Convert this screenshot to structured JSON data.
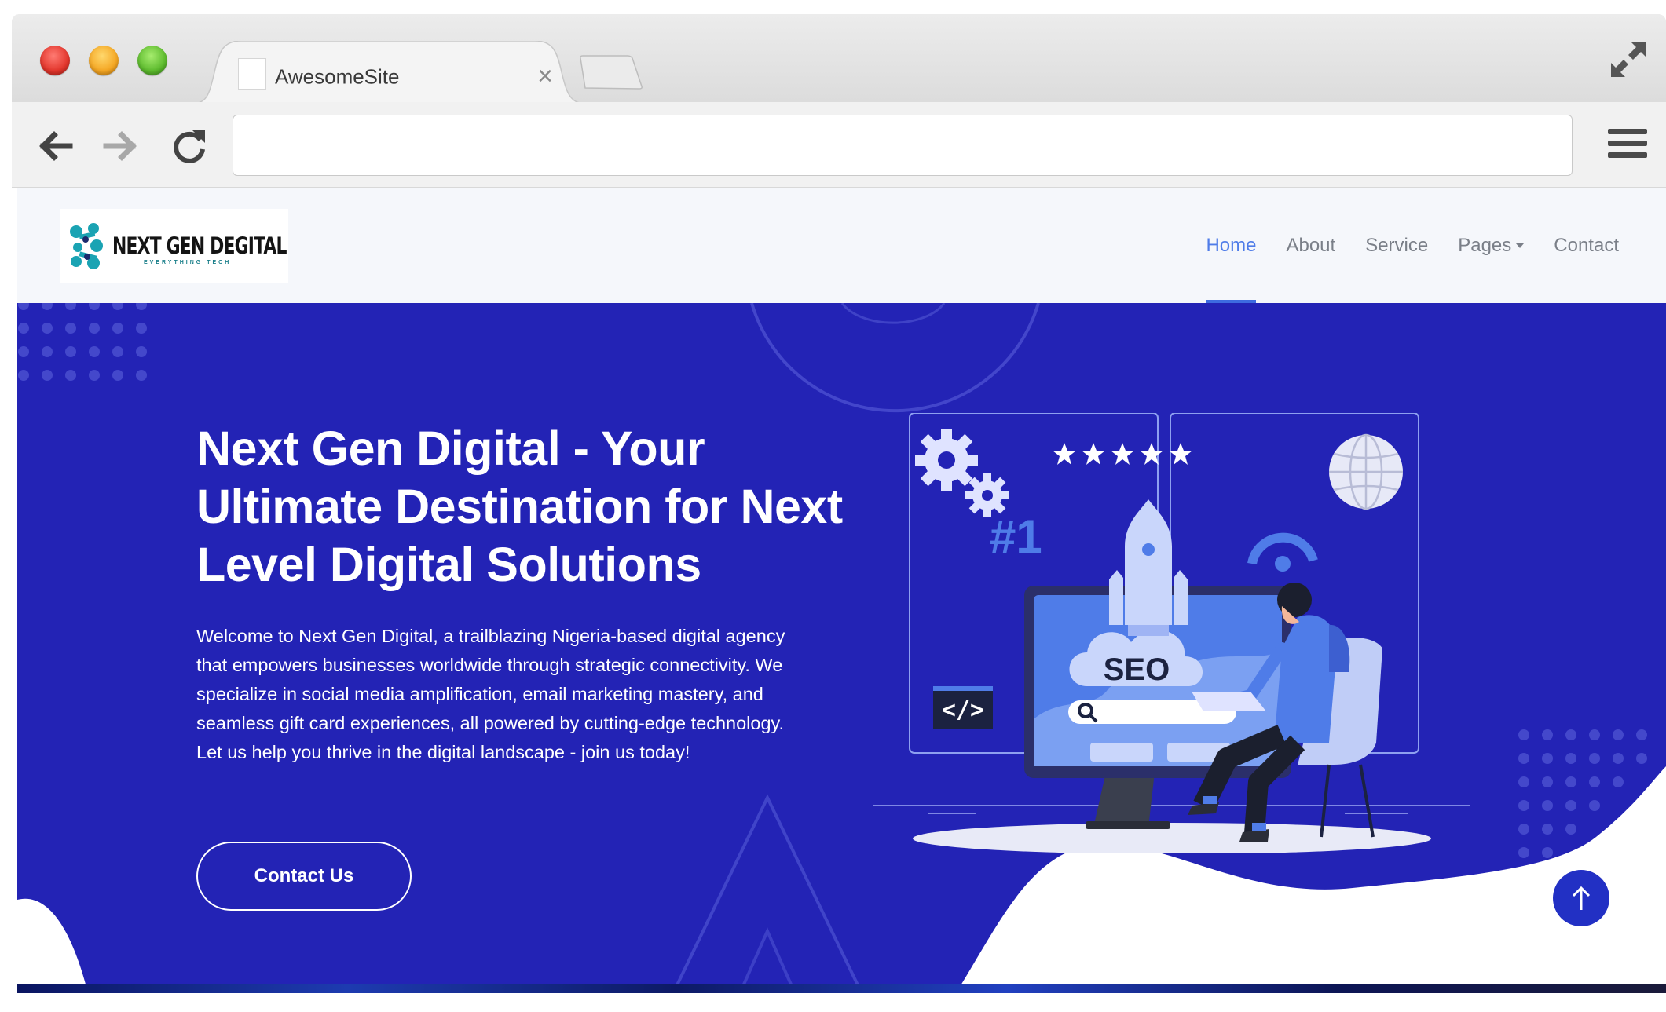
{
  "browser": {
    "tab_title": "AwesomeSite",
    "url": ""
  },
  "site": {
    "logo": {
      "name": "NEXT GEN DEGITAL",
      "tagline": "EVERYTHING TECH"
    },
    "nav": {
      "items": [
        {
          "label": "Home",
          "active": true
        },
        {
          "label": "About",
          "active": false
        },
        {
          "label": "Service",
          "active": false
        },
        {
          "label": "Pages",
          "active": false,
          "dropdown": true
        },
        {
          "label": "Contact",
          "active": false
        }
      ]
    },
    "hero": {
      "title": "Next Gen Digital - Your Ultimate Destination for Next Level Digital Solutions",
      "description": "Welcome to Next Gen Digital, a trailblazing Nigeria-based digital agency that empowers businesses worldwide through strategic connectivity. We specialize in social media amplification, email marketing mastery, and seamless gift card experiences, all powered by cutting-edge technology. Let us help you thrive in the digital landscape - join us today!",
      "cta_label": "Contact Us",
      "illustration": {
        "rank_label": "#1",
        "seo_label": "SEO",
        "code_label": "</>",
        "rating_stars": 5
      }
    }
  },
  "colors": {
    "hero_bg": "#2323b5",
    "nav_active": "#4f7ce8",
    "nav_text": "#7a7f88",
    "header_bg": "#f5f7fb",
    "logo_teal": "#1aa3b3"
  },
  "icons": {
    "back": "arrow-left-icon",
    "forward": "arrow-right-icon",
    "reload": "reload-icon",
    "menu": "hamburger-menu-icon",
    "expand": "fullscreen-expand-icon",
    "tab_close": "close-icon",
    "scroll_top": "arrow-up-icon"
  }
}
